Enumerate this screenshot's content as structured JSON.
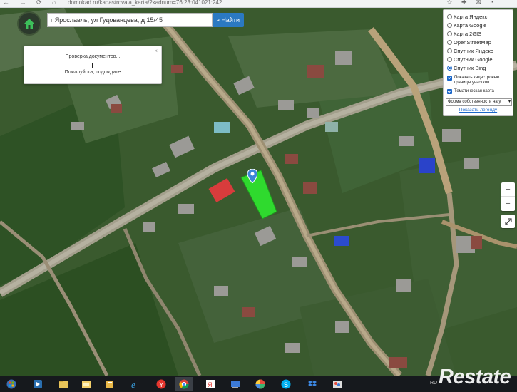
{
  "browser": {
    "url": "domokad.ru/kadastrovaia_karta/?kadnum=76:23:041021:242"
  },
  "search": {
    "value": "г Ярославль, ул Гудованцева, д 15/45",
    "button_label": "Найти"
  },
  "dialog": {
    "message": "Проверка документов...",
    "subtitle": "Пожалуйста, подождите",
    "close_label": "×"
  },
  "layers": {
    "options": [
      {
        "label": "Карта Яндекс",
        "selected": false
      },
      {
        "label": "Карта Google",
        "selected": false
      },
      {
        "label": "Карта 2GIS",
        "selected": false
      },
      {
        "label": "OpenStreetMap",
        "selected": false
      },
      {
        "label": "Спутник Яндекс",
        "selected": false
      },
      {
        "label": "Спутник Google",
        "selected": false
      },
      {
        "label": "Спутник Bing",
        "selected": true
      }
    ],
    "checkboxes": [
      {
        "label": "Показать кадастровые границы участков",
        "checked": true
      },
      {
        "label": "Тематическая карта",
        "checked": true
      }
    ],
    "select_value": "Форма собственности на у",
    "legend_link": "Показать легенду"
  },
  "zoom": {
    "in_label": "+",
    "out_label": "−"
  },
  "taskbar": {
    "language": "RU",
    "items": [
      "start",
      "media-player",
      "explorer",
      "files",
      "internet-explorer",
      "yandex-browser",
      "chrome",
      "yandex",
      "screenshot-tool",
      "picasa",
      "skype",
      "dropbox",
      "paint"
    ]
  },
  "watermark": "Restate",
  "colors": {
    "accent": "#2b79c2",
    "parcel": "#2ee82e",
    "marker": "#3b86d6"
  }
}
